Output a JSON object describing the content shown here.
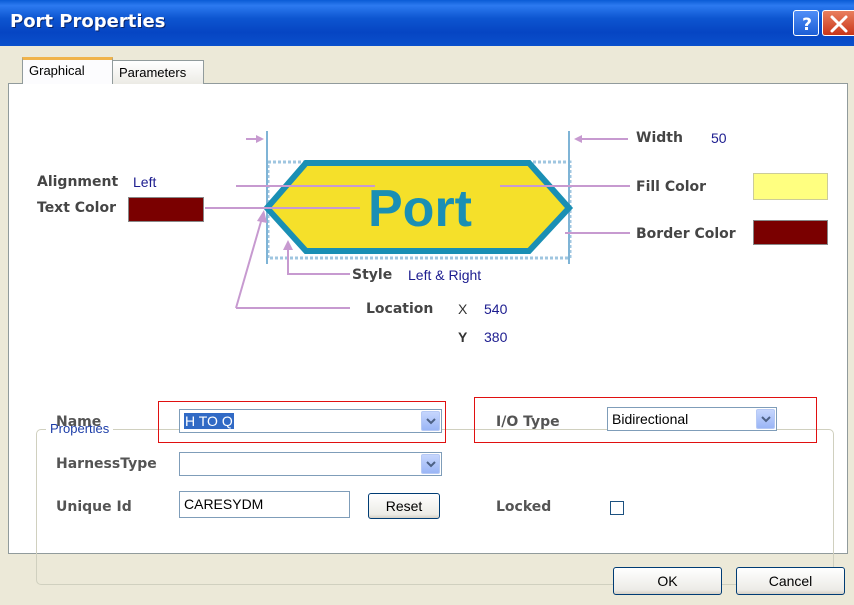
{
  "window": {
    "title": "Port Properties",
    "help_glyph": "?",
    "close_glyph": "X"
  },
  "tabs": [
    {
      "label": "Graphical",
      "active": true
    },
    {
      "label": "Parameters",
      "active": false
    }
  ],
  "diagram": {
    "port_text": "Port",
    "width_label": "Width",
    "width_value": "50",
    "alignment_label": "Alignment",
    "alignment_value": "Left",
    "text_color_label": "Text Color",
    "text_color": "#7a0000",
    "fill_color_label": "Fill Color",
    "fill_color": "#ffff80",
    "border_color_label": "Border Color",
    "border_color": "#7a0000",
    "style_label": "Style",
    "style_value": "Left & Right",
    "location_label": "Location",
    "x_label": "X",
    "x_value": "540",
    "y_label": "Y",
    "y_value": "380"
  },
  "properties": {
    "group_title": "Properties",
    "name_label": "Name",
    "name_value": "H TO Q",
    "io_type_label": "I/O Type",
    "io_type_value": "Bidirectional",
    "harness_type_label": "HarnessType",
    "harness_type_value": "",
    "unique_id_label": "Unique Id",
    "unique_id_value": "CARESYDM",
    "reset_label": "Reset",
    "locked_label": "Locked",
    "locked_checked": false
  },
  "footer": {
    "ok_label": "OK",
    "cancel_label": "Cancel"
  },
  "colors": {
    "port_fill": "#f5e02a",
    "port_border": "#1a8fb4",
    "port_text": "#1a8fb4",
    "leader": "#c79ad0",
    "highlight_box": "#e01010"
  }
}
